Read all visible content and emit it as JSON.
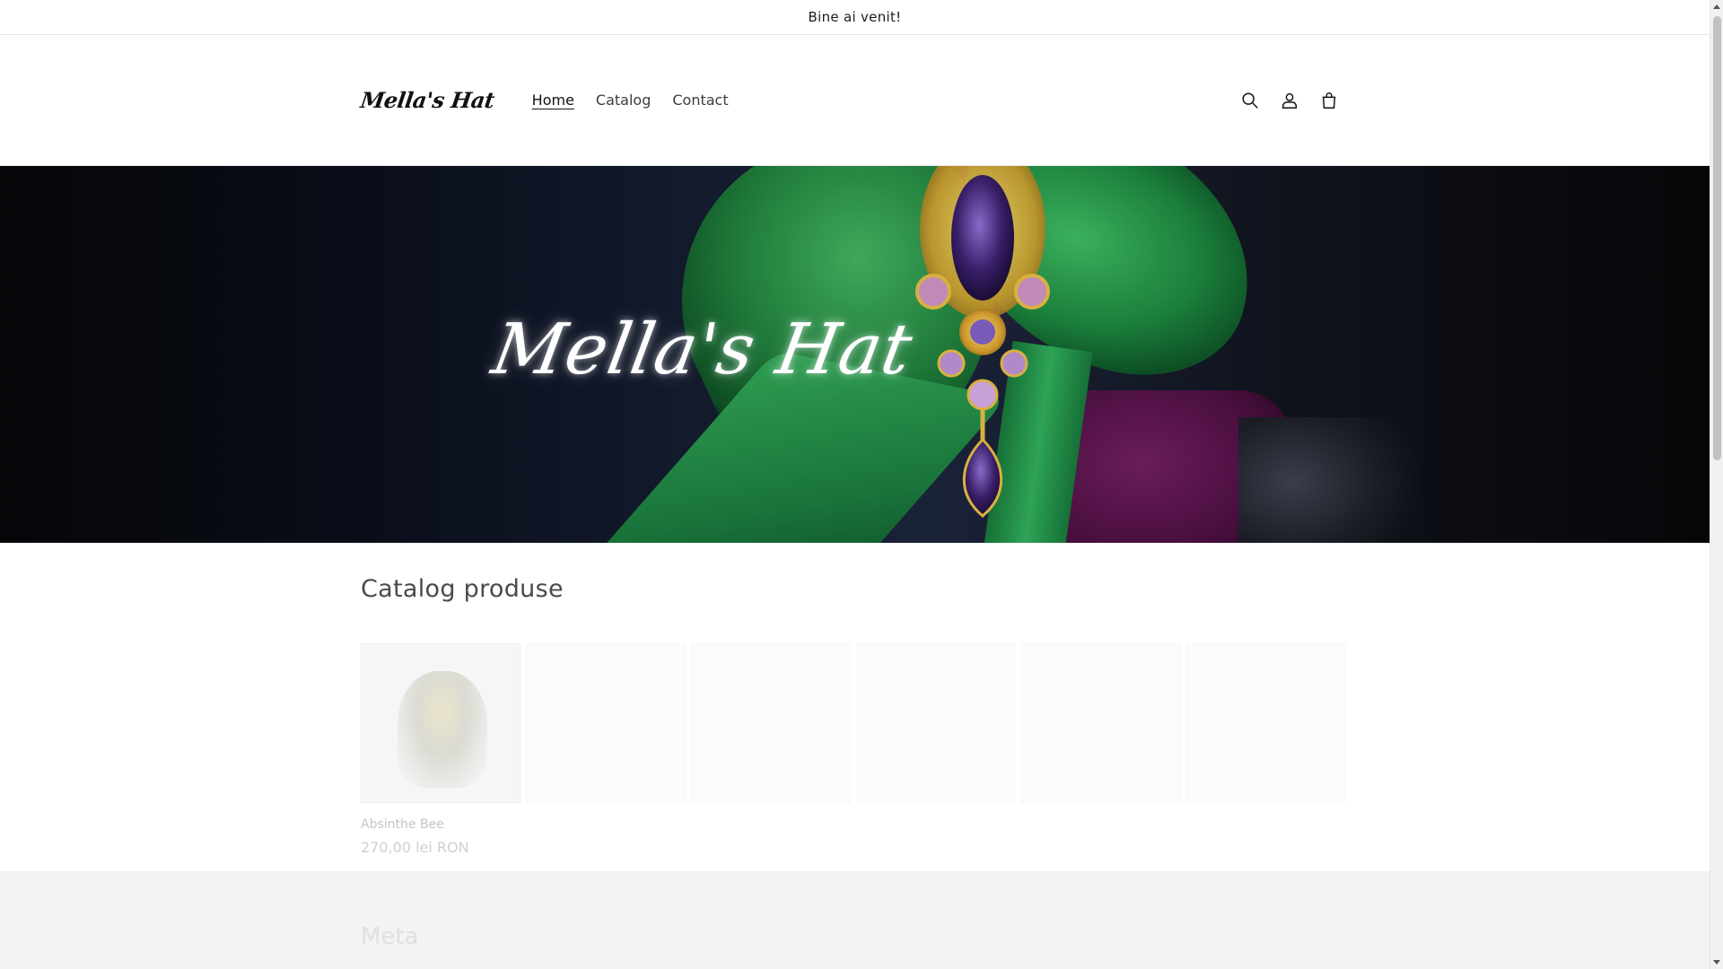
{
  "announcement": {
    "text": "Bine ai venit!"
  },
  "header": {
    "logo_text": "Mella's Hat",
    "nav": [
      {
        "label": "Home",
        "active": true
      },
      {
        "label": "Catalog",
        "active": false
      },
      {
        "label": "Contact",
        "active": false
      }
    ],
    "icons": [
      "search-icon",
      "account-icon",
      "cart-icon"
    ]
  },
  "hero": {
    "title": "Mella's Hat"
  },
  "catalog": {
    "title": "Catalog produse",
    "products": [
      {
        "name": "Absinthe Bee",
        "price": "270,00 lei RON"
      }
    ]
  },
  "footer_band": {
    "title": "Meta"
  },
  "colors": {
    "text": "#121212",
    "muted": "#3c3c3c",
    "band": "#f3f3f3",
    "ribbon_green": "#1f7a3a",
    "velvet_purple": "#4a0f40"
  }
}
